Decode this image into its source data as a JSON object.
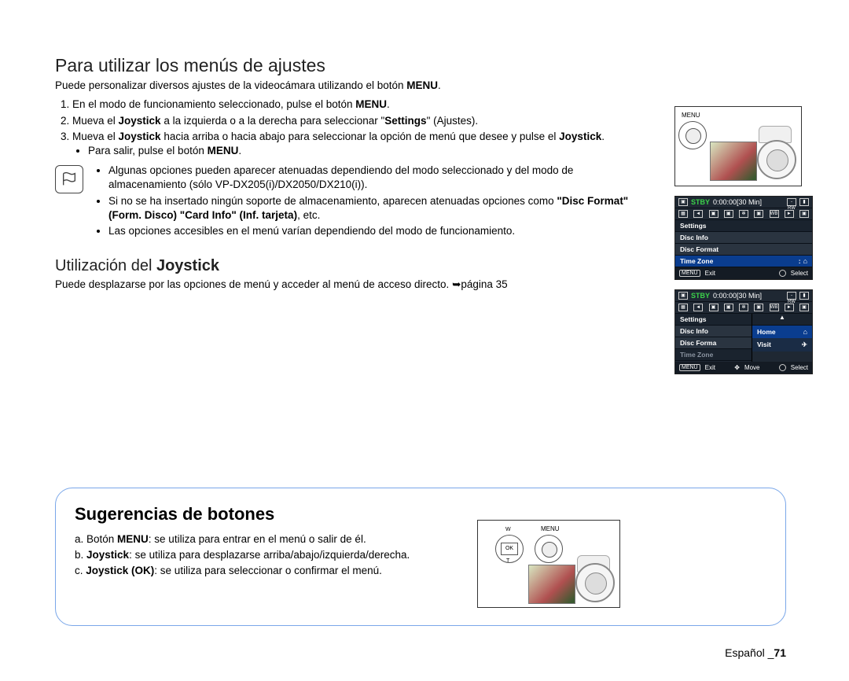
{
  "heading1": "Para utilizar los menús de ajustes",
  "intro1": "Puede personalizar diversos ajustes de la videocámara utilizando el botón ",
  "intro1_bold": "MENU",
  "intro1_end": ".",
  "step1_a": "En el modo de funcionamiento seleccionado, pulse el botón ",
  "step1_b": "MENU",
  "step1_c": ".",
  "step2_a": "Mueva el ",
  "step2_b": "Joystick",
  "step2_c": " a la izquierda o a la derecha para seleccionar \"",
  "step2_d": "Settings",
  "step2_e": "\" (Ajustes).",
  "step3_a": "Mueva el ",
  "step3_b": "Joystick",
  "step3_c": " hacia arriba o hacia abajo para seleccionar la opción de menú que desee y pulse el ",
  "step3_d": "Joystick",
  "step3_e": ".",
  "exit_a": "Para salir, pulse el botón ",
  "exit_b": "MENU",
  "exit_c": ".",
  "note1": "Algunas opciones pueden aparecer atenuadas dependiendo del modo seleccionado y del modo de almacenamiento (sólo VP-DX205(i)/DX2050/DX210(i)).",
  "note2_a": "Si no se ha insertado ningún soporte de almacenamiento, aparecen atenuadas opciones como ",
  "note2_b": "\"Disc Format\" (Form. Disco) \"Card Info\" (Inf. tarjeta)",
  "note2_c": ", etc.",
  "note3": "Las opciones accesibles en el menú varían dependiendo del modo de funcionamiento.",
  "heading2_a": "Utilización del ",
  "heading2_b": "Joystick",
  "joy_a": "Puede desplazarse por las opciones de menú y acceder al menú de acceso directo. ",
  "joy_b": "➥página 35",
  "lcd": {
    "stby": "STBY",
    "time": "0:00:00[30 Min]",
    "rw": "-RW",
    "settings": "Settings",
    "discinfo": "Disc Info",
    "discformat": "Disc Format",
    "timezone": "Time Zone",
    "menu": "MENU",
    "exit": "Exit",
    "select": "Select",
    "move": "Move",
    "home": "Home",
    "visit": "Visit",
    "discformat_trunc": "Disc Forma"
  },
  "tips": {
    "title": "Sugerencias de botones",
    "a_pre": "a.   Botón ",
    "a_bold": "MENU",
    "a_post": ": se utiliza para entrar en el menú o salir de él.",
    "b_pre": "b.   ",
    "b_bold": "Joystick",
    "b_post": ": se utiliza para desplazarse arriba/abajo/izquierda/derecha.",
    "c_pre": "c.   ",
    "c_bold": "Joystick (OK)",
    "c_post": ": se utiliza para seleccionar o confirmar el menú.",
    "menu_label": "MENU",
    "ok": "OK",
    "w": "W",
    "t": "T"
  },
  "footer_lang": "Español _",
  "footer_page": "71"
}
